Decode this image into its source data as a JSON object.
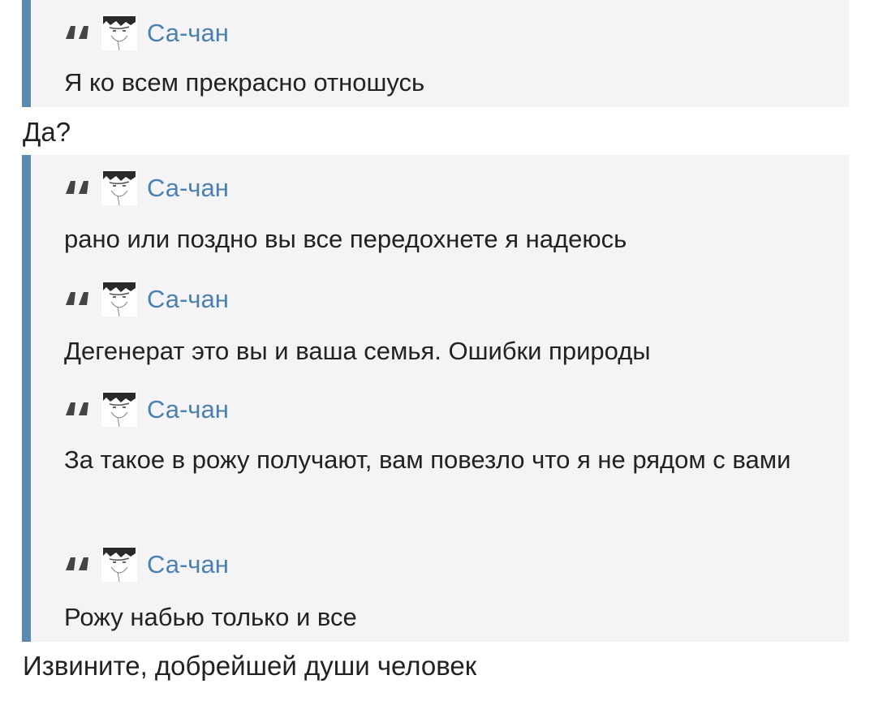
{
  "quotes": [
    {
      "author": "Са-чан",
      "text": "Я ко всем прекрасно отношусь",
      "avatar_icon": "manga-avatar-icon",
      "quote_icon": "quote-mark-icon"
    },
    {
      "author": "Са-чан",
      "text": "рано или поздно вы все передохнете я надеюсь",
      "avatar_icon": "manga-avatar-icon",
      "quote_icon": "quote-mark-icon"
    },
    {
      "author": "Са-чан",
      "text": "Дегенерат это вы и ваша семья. Ошибки природы",
      "avatar_icon": "manga-avatar-icon",
      "quote_icon": "quote-mark-icon"
    },
    {
      "author": "Са-чан",
      "text": "За такое в рожу получают, вам повезло что я не рядом с вами",
      "avatar_icon": "manga-avatar-icon",
      "quote_icon": "quote-mark-icon"
    },
    {
      "author": "Са-чан",
      "text": "Рожу набью только и все",
      "avatar_icon": "manga-avatar-icon",
      "quote_icon": "quote-mark-icon"
    }
  ],
  "replies": [
    "Да?",
    "Извините, добрейшей души человек"
  ],
  "colors": {
    "quote_bar": "#5b8ab0",
    "quote_background": "#f4f4f6",
    "author_link": "#4b81b0",
    "text": "#222222"
  }
}
